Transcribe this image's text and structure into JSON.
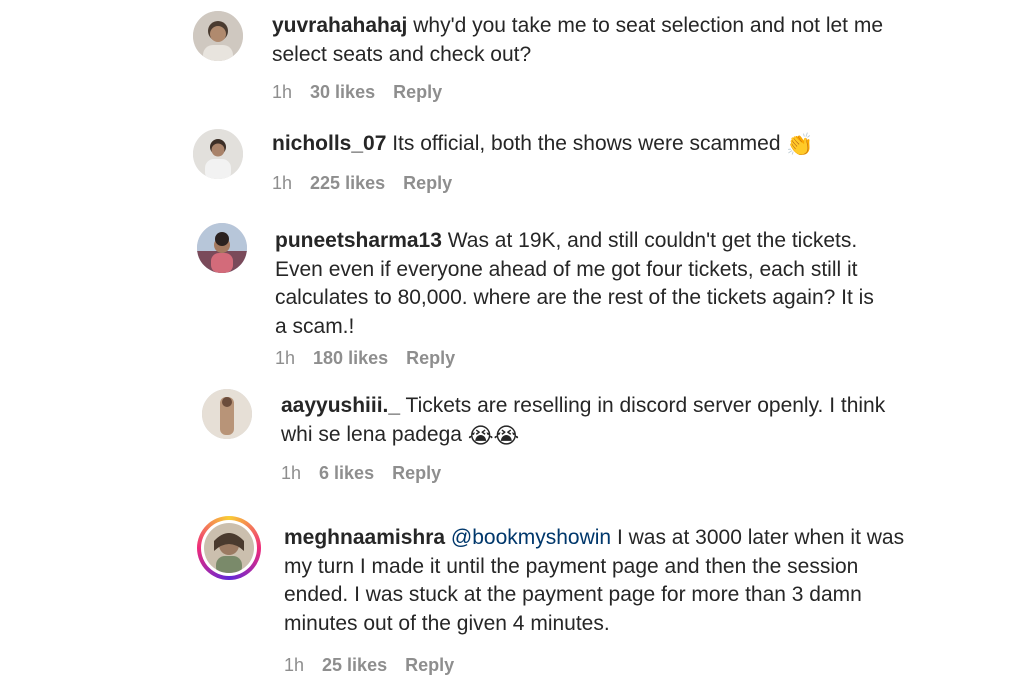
{
  "comments": [
    {
      "username": "yuvrahahahaj",
      "text": " why'd you take me to seat selection and not let me select seats and check out?",
      "time": "1h",
      "likes": "30 likes",
      "reply": "Reply"
    },
    {
      "username": "nicholls_07",
      "text": " Its official, both the shows were scammed ",
      "emoji": "👏",
      "time": "1h",
      "likes": "225 likes",
      "reply": "Reply"
    },
    {
      "username": "puneetsharma13",
      "text": " Was at 19K, and still couldn't get the tickets. Even even if everyone ahead of me got four tickets, each still it calculates to 80,000. where are the rest of the tickets again? It is a scam.!",
      "time": "1h",
      "likes": "180 likes",
      "reply": "Reply"
    },
    {
      "username": "aayyushiii._",
      "text": " Tickets are reselling in discord server openly. I think whi se lena padega ",
      "emoji": "😭😭",
      "time": "1h",
      "likes": "6 likes",
      "reply": "Reply"
    },
    {
      "username": "meghnaamishra",
      "mention": " @bookmyshowin",
      "text": " I was at 3000 later when it was my turn I made it until the payment page and then the session ended. I was stuck at the payment page for more than 3 damn minutes out of the given 4 minutes.",
      "time": "1h",
      "likes": "25 likes",
      "reply": "Reply"
    }
  ]
}
